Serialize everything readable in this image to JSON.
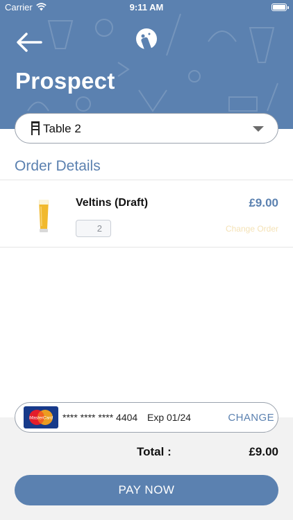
{
  "status_bar": {
    "carrier": "Carrier",
    "time": "9:11 AM"
  },
  "header": {
    "venue_name": "Prospect",
    "back_icon": "arrow-left-icon",
    "logo_icon": "beer-tap-logo-icon"
  },
  "table_selector": {
    "selected": "Table 2",
    "icon": "chair-icon"
  },
  "section_title": "Order Details",
  "order_items": [
    {
      "name": "Veltins (Draft)",
      "price": "£9.00",
      "quantity": "2",
      "change_label": "Change Order",
      "image_icon": "beer-glass-icon"
    }
  ],
  "payment": {
    "card_brand": "MasterCard",
    "masked_number": "**** **** **** 4404",
    "expiry": "Exp 01/24",
    "change_label": "CHANGE"
  },
  "totals": {
    "label": "Total :",
    "value": "£9.00"
  },
  "pay_button": "PAY NOW",
  "colors": {
    "primary": "#5b81b0",
    "change_order": "#f4e2b6",
    "panel": "#f2f2f2"
  }
}
